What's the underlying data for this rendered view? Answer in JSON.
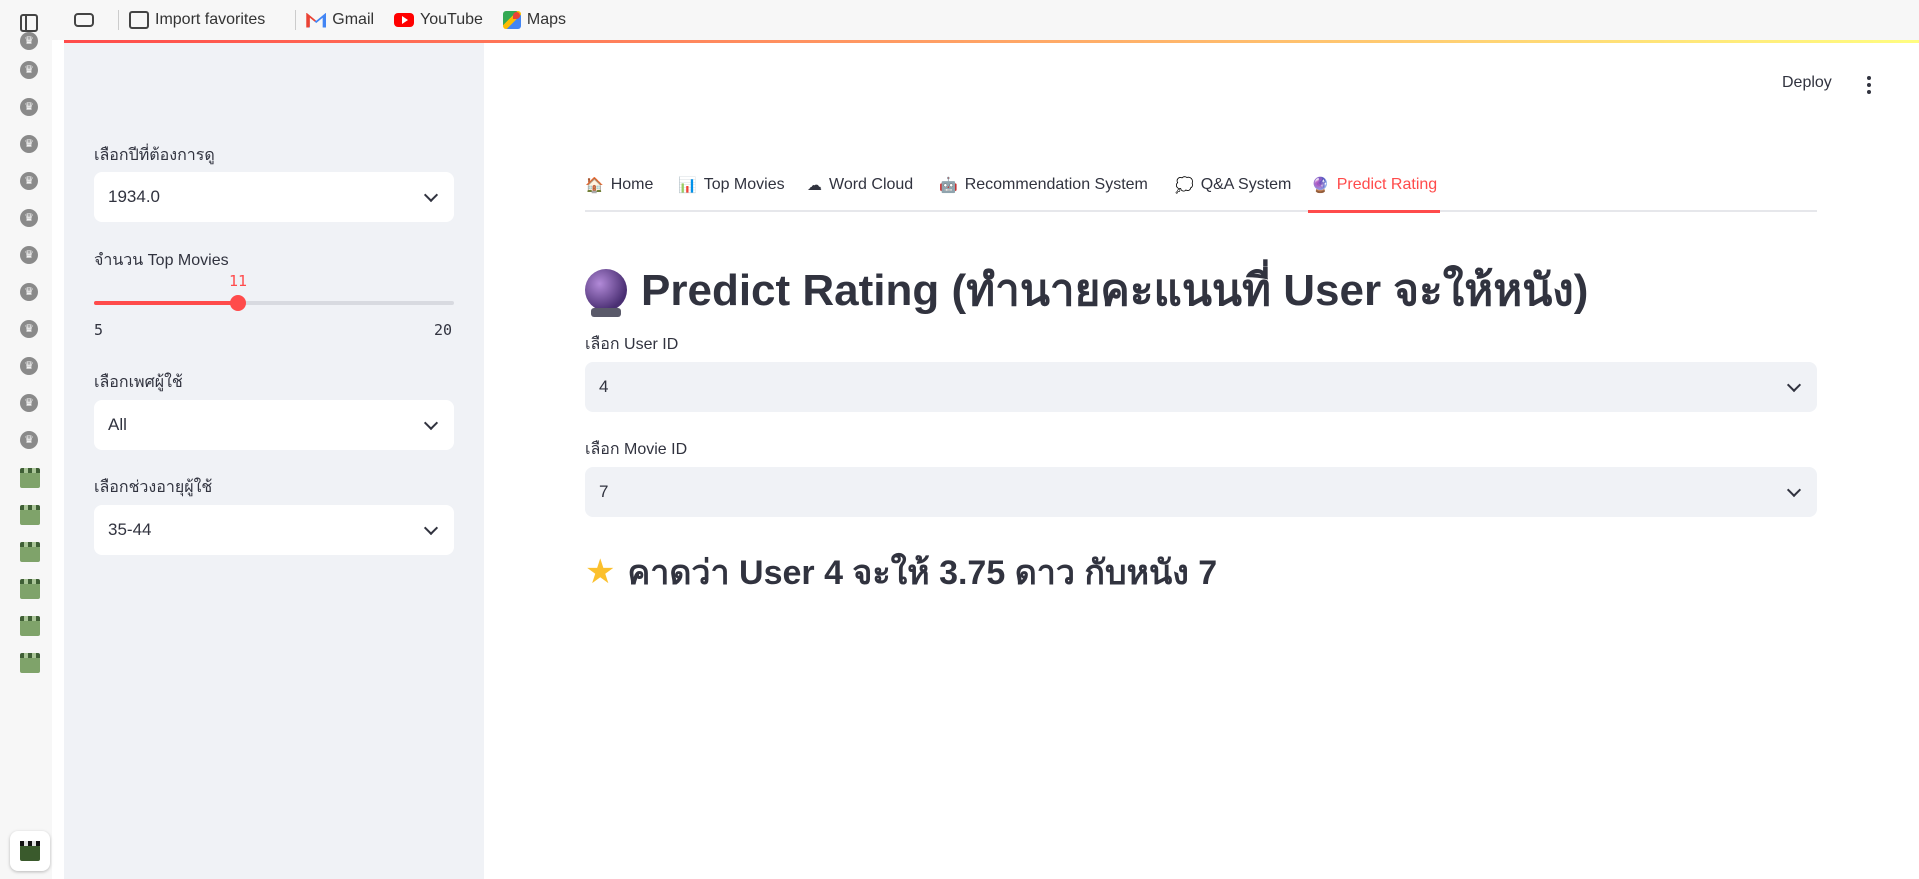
{
  "browser": {
    "bookmarks": [
      {
        "label": "Import favorites",
        "icon": "import-icon"
      },
      {
        "label": "Gmail",
        "icon": "gmail-icon"
      },
      {
        "label": "YouTube",
        "icon": "youtube-icon"
      },
      {
        "label": "Maps",
        "icon": "maps-icon"
      }
    ]
  },
  "header": {
    "deploy_label": "Deploy"
  },
  "sidebar": {
    "year_label": "เลือกปีที่ต้องการดู",
    "year_value": "1934.0",
    "top_label": "จำนวน Top Movies",
    "top_slider": {
      "value": "11",
      "min": "5",
      "max": "20"
    },
    "gender_label": "เลือกเพศผู้ใช้",
    "gender_value": "All",
    "age_label": "เลือกช่วงอายุผู้ใช้",
    "age_value": "35-44"
  },
  "tabs": [
    {
      "icon": "🏠",
      "label": "Home"
    },
    {
      "icon": "📊",
      "label": "Top Movies"
    },
    {
      "icon": "☁",
      "label": "Word Cloud"
    },
    {
      "icon": "🤖",
      "label": "Recommendation System"
    },
    {
      "icon": "💭",
      "label": "Q&A System"
    },
    {
      "icon": "🔮",
      "label": "Predict Rating",
      "active": true
    }
  ],
  "main": {
    "title": "Predict Rating (ทำนายคะแนนที่ User จะให้หนัง)",
    "user_label": "เลือก User ID",
    "user_value": "4",
    "movie_label": "เลือก Movie ID",
    "movie_value": "7",
    "result_text": "คาดว่า User 4 จะให้ 3.75 ดาว กับหนัง 7"
  },
  "colors": {
    "accent": "#ff4b4b",
    "sidebar_bg": "#f0f2f6",
    "text": "#31333f"
  }
}
